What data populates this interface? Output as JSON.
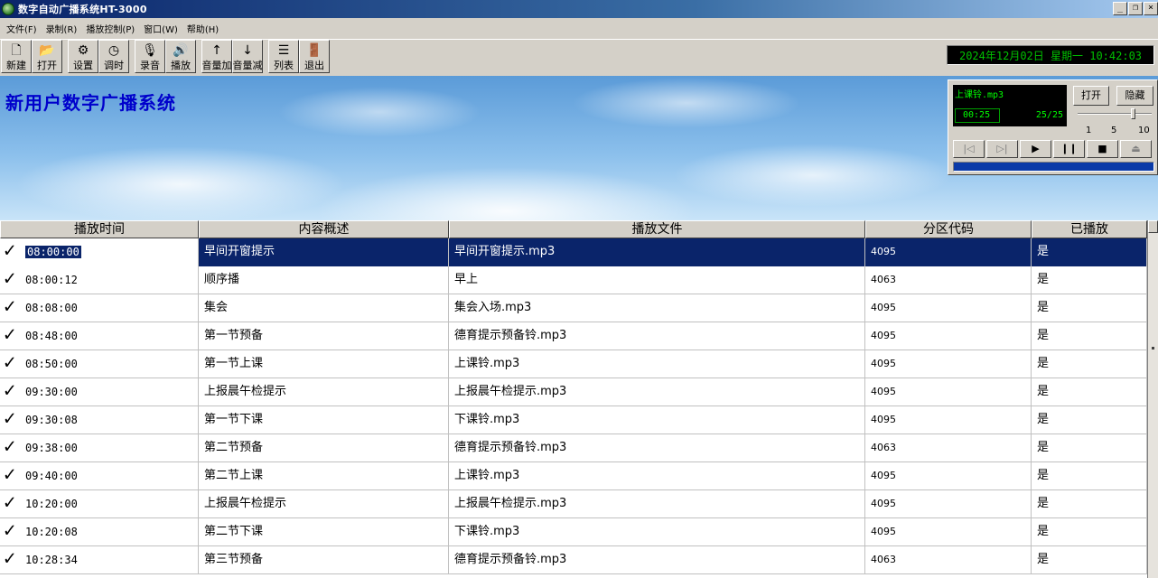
{
  "window": {
    "title": "数字自动广播系统HT-3000"
  },
  "menu": [
    {
      "label": "文件(F)"
    },
    {
      "label": "录制(R)"
    },
    {
      "label": "播放控制(P)"
    },
    {
      "label": "窗口(W)"
    },
    {
      "label": "帮助(H)"
    }
  ],
  "toolbar": {
    "new": "新建",
    "open": "打开",
    "settings": "设置",
    "time": "调时",
    "record": "录音",
    "play": "播放",
    "vol_up": "音量加",
    "vol_down": "音量减",
    "list": "列表",
    "exit": "退出"
  },
  "clock": "2024年12月02日 星期一  10:42:03",
  "banner": {
    "title": "新用户数字广播系统"
  },
  "player": {
    "file": "上课铃.mp3",
    "time": "00:25",
    "count": "25/25",
    "open_label": "打开",
    "hide_label": "隐藏",
    "scale_min": "1",
    "scale_mid": "5",
    "scale_max": "10",
    "volume_level": 8,
    "progress_fraction": 1.0
  },
  "table": {
    "columns": [
      "播放时间",
      "内容概述",
      "播放文件",
      "分区代码",
      "已播放"
    ],
    "rows": [
      {
        "time": "08:00:00",
        "desc": "早间开窗提示",
        "file": "早间开窗提示.mp3",
        "zone": "4095",
        "played": "是"
      },
      {
        "time": "08:00:12",
        "desc": "顺序播",
        "file": "早上",
        "zone": "4063",
        "played": "是"
      },
      {
        "time": "08:08:00",
        "desc": "集会",
        "file": "集会入场.mp3",
        "zone": "4095",
        "played": "是"
      },
      {
        "time": "08:48:00",
        "desc": "第一节预备",
        "file": "德育提示预备铃.mp3",
        "zone": "4095",
        "played": "是"
      },
      {
        "time": "08:50:00",
        "desc": "第一节上课",
        "file": "上课铃.mp3",
        "zone": "4095",
        "played": "是"
      },
      {
        "time": "09:30:00",
        "desc": "上报晨午检提示",
        "file": "上报晨午检提示.mp3",
        "zone": "4095",
        "played": "是"
      },
      {
        "time": "09:30:08",
        "desc": "第一节下课",
        "file": "下课铃.mp3",
        "zone": "4095",
        "played": "是"
      },
      {
        "time": "09:38:00",
        "desc": "第二节预备",
        "file": "德育提示预备铃.mp3",
        "zone": "4063",
        "played": "是"
      },
      {
        "time": "09:40:00",
        "desc": "第二节上课",
        "file": "上课铃.mp3",
        "zone": "4095",
        "played": "是"
      },
      {
        "time": "10:20:00",
        "desc": "上报晨午检提示",
        "file": "上报晨午检提示.mp3",
        "zone": "4095",
        "played": "是"
      },
      {
        "time": "10:20:08",
        "desc": "第二节下课",
        "file": "下课铃.mp3",
        "zone": "4095",
        "played": "是"
      },
      {
        "time": "10:28:34",
        "desc": "第三节预备",
        "file": "德育提示预备铃.mp3",
        "zone": "4063",
        "played": "是"
      }
    ]
  }
}
